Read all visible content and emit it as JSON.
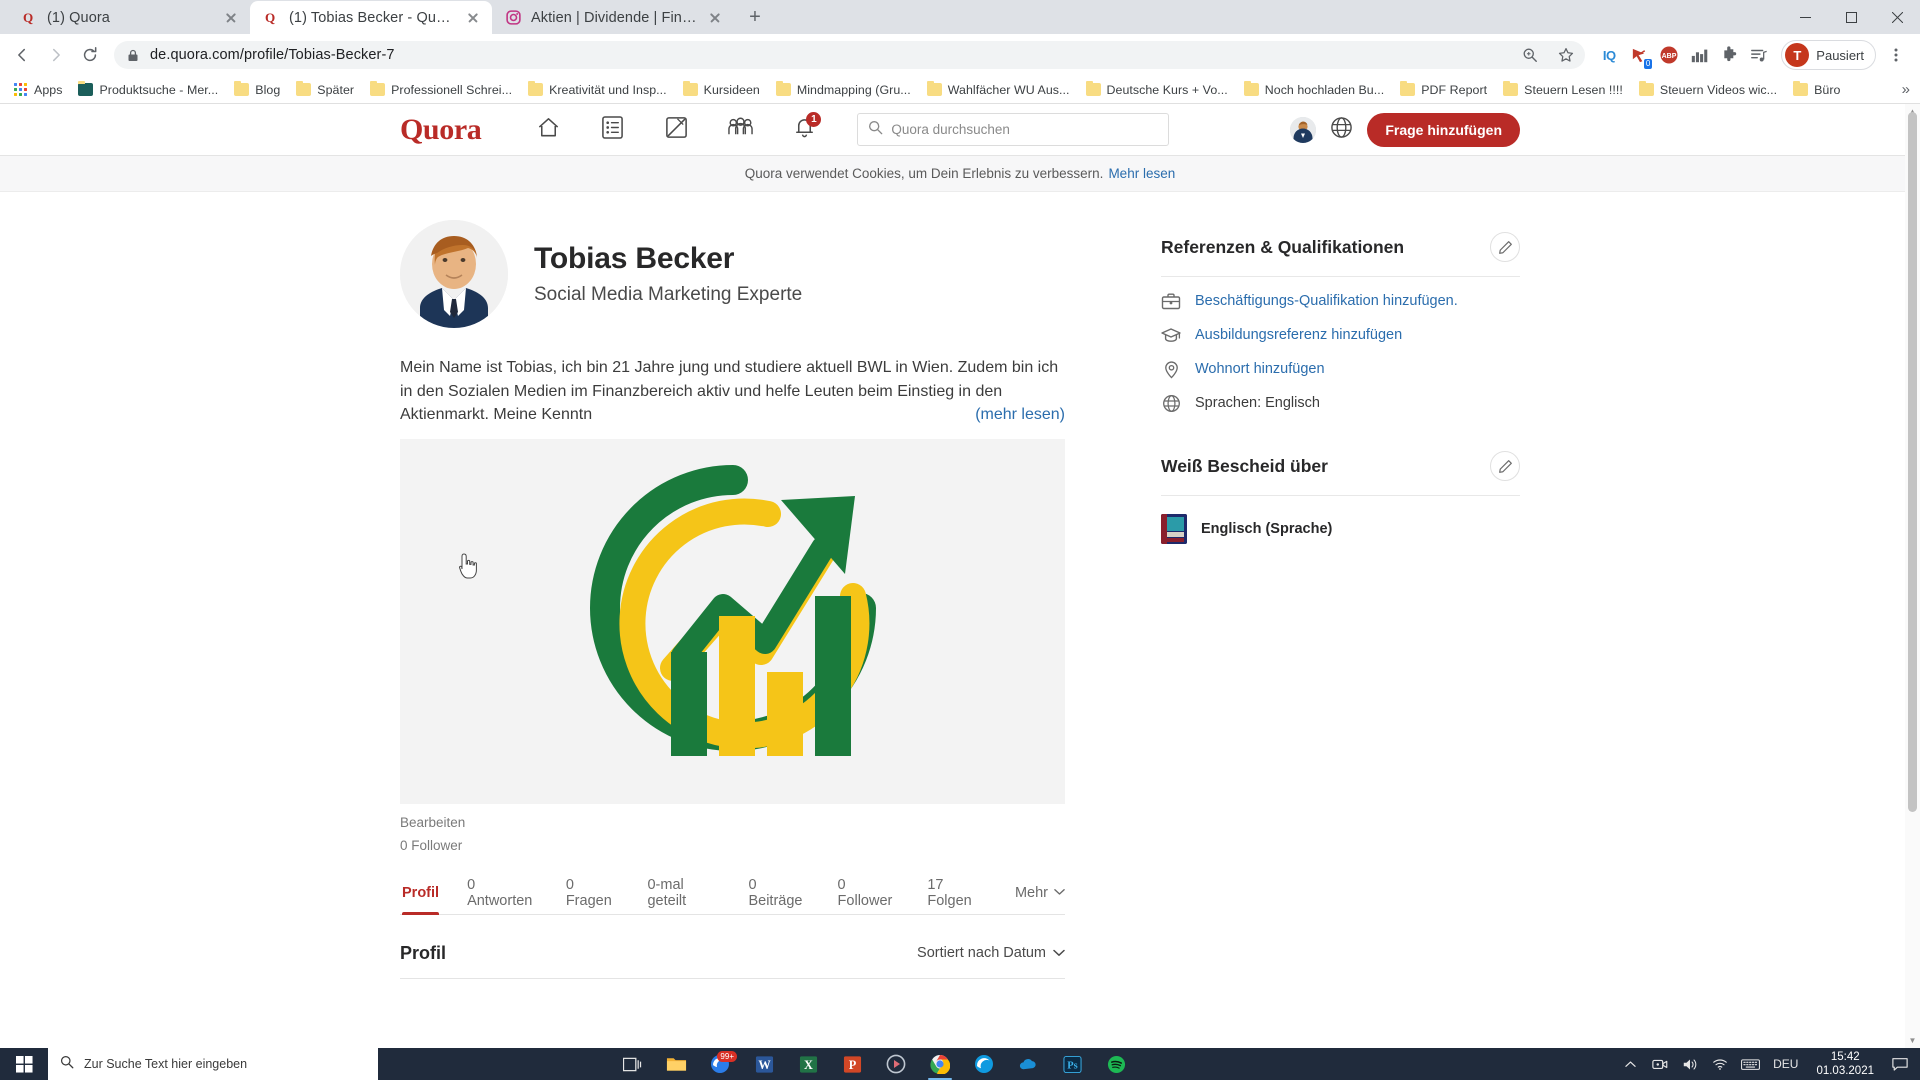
{
  "browser": {
    "tabs": [
      {
        "title": "(1) Quora",
        "favicon": "quora-icon",
        "active": false
      },
      {
        "title": "(1) Tobias Becker - Quora",
        "favicon": "quora-icon",
        "active": true
      },
      {
        "title": "Aktien | Dividende | Finanzen (@",
        "favicon": "instagram-icon",
        "active": false
      }
    ],
    "new_tab_label": "+",
    "window_controls": {
      "minimize": "–",
      "maximize": "□",
      "close": "✕"
    },
    "nav": {
      "back": "←",
      "forward": "→",
      "reload": "↻"
    },
    "omnibox": {
      "url": "de.quora.com/profile/Tobias-Becker-7",
      "lock_icon": "lock-icon",
      "zoom_icon": "zoom-search-icon",
      "bookmark_icon": "star-icon"
    },
    "extensions": [
      {
        "name": "iq-extension",
        "label": "IQ"
      },
      {
        "name": "pocket-extension",
        "label": "",
        "badge": "0"
      },
      {
        "name": "adblock-plus-extension",
        "label": "ABP"
      },
      {
        "name": "stats-extension",
        "label": ""
      },
      {
        "name": "puzzle-extensions-menu",
        "label": ""
      },
      {
        "name": "playlist-extension",
        "label": ""
      }
    ],
    "profile": {
      "initial": "T",
      "label": "Pausiert"
    },
    "menu_icon": "kebab-menu-icon",
    "bookmarks": [
      {
        "label": "Apps",
        "icon": "apps-grid-icon"
      },
      {
        "label": "Produktsuche - Mer...",
        "icon": "site-icon"
      },
      {
        "label": "Blog",
        "icon": "folder-icon"
      },
      {
        "label": "Später",
        "icon": "folder-icon"
      },
      {
        "label": "Professionell Schrei...",
        "icon": "folder-icon"
      },
      {
        "label": "Kreativität und Insp...",
        "icon": "folder-icon"
      },
      {
        "label": "Kursideen",
        "icon": "folder-icon"
      },
      {
        "label": "Mindmapping  (Gru...",
        "icon": "folder-icon"
      },
      {
        "label": "Wahlfächer WU Aus...",
        "icon": "folder-icon"
      },
      {
        "label": "Deutsche Kurs + Vo...",
        "icon": "folder-icon"
      },
      {
        "label": "Noch hochladen Bu...",
        "icon": "folder-icon"
      },
      {
        "label": "PDF Report",
        "icon": "folder-icon"
      },
      {
        "label": "Steuern Lesen !!!!",
        "icon": "folder-icon"
      },
      {
        "label": "Steuern Videos wic...",
        "icon": "folder-icon"
      },
      {
        "label": "Büro",
        "icon": "folder-icon"
      }
    ],
    "bookmarks_overflow": "»"
  },
  "quora": {
    "logo": "Quora",
    "nav": [
      {
        "name": "home-icon",
        "label": "Startseite"
      },
      {
        "name": "answers-list-icon",
        "label": "Antworten"
      },
      {
        "name": "write-pencil-icon",
        "label": "Schreiben"
      },
      {
        "name": "spaces-group-icon",
        "label": "Spaces"
      },
      {
        "name": "notifications-bell-icon",
        "label": "Benachrichtigungen",
        "badge": "1"
      }
    ],
    "search_placeholder": "Quora durchsuchen",
    "search_icon": "search-icon",
    "globe_icon": "globe-language-icon",
    "avatar": "user-avatar",
    "ask_button": "Frage hinzufügen",
    "brand_color": "#b92b27"
  },
  "cookie_banner": {
    "text": "Quora verwendet Cookies, um Dein Erlebnis zu verbessern.",
    "link": "Mehr lesen"
  },
  "profile": {
    "name": "Tobias Becker",
    "tagline": "Social Media Marketing Experte",
    "bio": "Mein Name ist Tobias, ich bin 21 Jahre jung und studiere aktuell BWL in Wien. Zudem bin ich in den Sozialen Medien im Finanzbereich aktiv und helfe Leuten beim Einstieg in den Aktienmarkt. Meine Kenntn",
    "read_more": "(mehr lesen)",
    "edit_link": "Bearbeiten",
    "followers": "0 Follower",
    "tabs": [
      {
        "label": "Profil",
        "active": true
      },
      {
        "label": "0 Antworten",
        "active": false
      },
      {
        "label": "0 Fragen",
        "active": false
      },
      {
        "label": "0-mal geteilt",
        "active": false
      },
      {
        "label": "0 Beiträge",
        "active": false
      },
      {
        "label": "0 Follower",
        "active": false
      },
      {
        "label": "17 Folgen",
        "active": false
      },
      {
        "label": "Mehr",
        "active": false,
        "chevron": "⌄"
      }
    ],
    "section_title": "Profil",
    "sort_label": "Sortiert nach Datum",
    "sort_chevron": "⌄"
  },
  "sidebar": {
    "credentials": {
      "title": "Referenzen & Qualifikationen",
      "edit_icon": "pencil-edit-icon",
      "items": [
        {
          "icon": "briefcase-icon",
          "label": "Beschäftigungs-Qualifikation hinzufügen.",
          "link": true
        },
        {
          "icon": "graduation-cap-icon",
          "label": "Ausbildungsreferenz hinzufügen",
          "link": true
        },
        {
          "icon": "location-pin-icon",
          "label": "Wohnort hinzufügen",
          "link": true
        },
        {
          "icon": "globe-icon",
          "label": "Sprachen: Englisch",
          "link": false
        }
      ]
    },
    "knows_about": {
      "title": "Weiß Bescheid über",
      "edit_icon": "pencil-edit-icon",
      "items": [
        {
          "thumb": "dictionary-book-thumb",
          "label": "Englisch (Sprache)"
        }
      ]
    }
  },
  "taskbar": {
    "start_icon": "windows-start-icon",
    "search_placeholder": "Zur Suche Text hier eingeben",
    "search_icon": "search-icon",
    "apps": [
      {
        "name": "task-view-icon"
      },
      {
        "name": "file-explorer-icon"
      },
      {
        "name": "edge-icon",
        "badge": "99+"
      },
      {
        "name": "word-icon"
      },
      {
        "name": "excel-icon"
      },
      {
        "name": "powerpoint-icon"
      },
      {
        "name": "media-player-icon"
      },
      {
        "name": "chrome-icon",
        "running": true
      },
      {
        "name": "edge-chromium-icon"
      },
      {
        "name": "onedrive-icon"
      },
      {
        "name": "photoshop-icon"
      },
      {
        "name": "spotify-icon"
      }
    ],
    "tray": [
      {
        "name": "show-hidden-icons-chevron"
      },
      {
        "name": "camera-icon"
      },
      {
        "name": "volume-icon"
      },
      {
        "name": "wifi-icon"
      },
      {
        "name": "keyboard-icon"
      }
    ],
    "language": "DEU",
    "time": "15:42",
    "date": "01.03.2021",
    "notification_icon": "action-center-icon"
  }
}
